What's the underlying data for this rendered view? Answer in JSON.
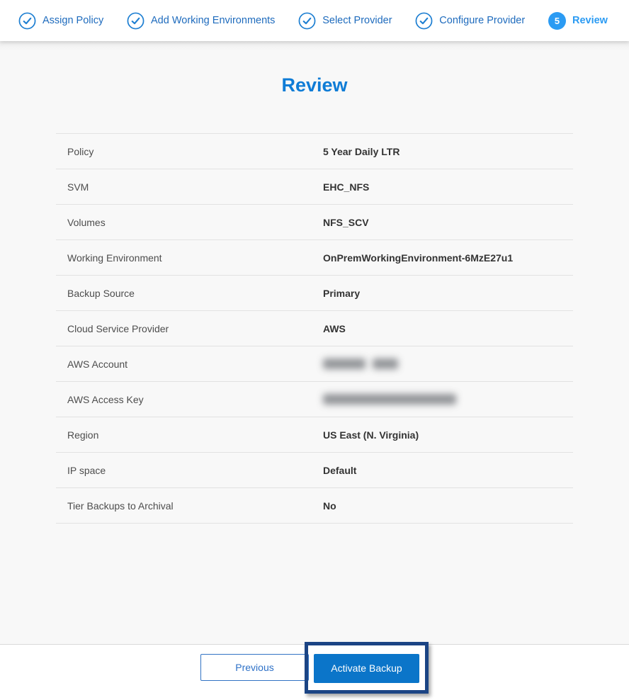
{
  "wizard": {
    "steps": [
      {
        "label": "Assign Policy",
        "state": "completed",
        "icon": "check"
      },
      {
        "label": "Add Working Environments",
        "state": "completed",
        "icon": "check"
      },
      {
        "label": "Select Provider",
        "state": "completed",
        "icon": "check"
      },
      {
        "label": "Configure Provider",
        "state": "completed",
        "icon": "check"
      },
      {
        "label": "Review",
        "state": "active",
        "number": "5"
      }
    ]
  },
  "page": {
    "title": "Review"
  },
  "review": {
    "rows": [
      {
        "label": "Policy",
        "value": "5 Year Daily LTR",
        "redacted": false
      },
      {
        "label": "SVM",
        "value": "EHC_NFS",
        "redacted": false
      },
      {
        "label": "Volumes",
        "value": "NFS_SCV",
        "redacted": false
      },
      {
        "label": "Working Environment",
        "value": "OnPremWorkingEnvironment-6MzE27u1",
        "redacted": false
      },
      {
        "label": "Backup Source",
        "value": "Primary",
        "redacted": false
      },
      {
        "label": "Cloud Service Provider",
        "value": "AWS",
        "redacted": false
      },
      {
        "label": "AWS Account",
        "value": "",
        "redacted": true,
        "redaction_widths": [
          60,
          36
        ]
      },
      {
        "label": "AWS Access Key",
        "value": "",
        "redacted": true,
        "redaction_widths": [
          188
        ]
      },
      {
        "label": "Region",
        "value": "US East (N. Virginia)",
        "redacted": false
      },
      {
        "label": "IP space",
        "value": "Default",
        "redacted": false
      },
      {
        "label": "Tier Backups to Archival",
        "value": "No",
        "redacted": false
      }
    ]
  },
  "footer": {
    "previous_label": "Previous",
    "activate_label": "Activate Backup"
  },
  "colors": {
    "step_completed_text": "#1e6bbd",
    "step_active_text": "#2b9bf3",
    "step_badge_fill": "#2b9bf3",
    "check_icon": "#1e7fd2",
    "title_blue": "#0f7cd6",
    "primary_button": "#0b75c9",
    "annotation_highlight": "#1b4484",
    "row_label": "#4d4d4d",
    "row_value": "#333333",
    "divider": "#e2e2e2"
  }
}
